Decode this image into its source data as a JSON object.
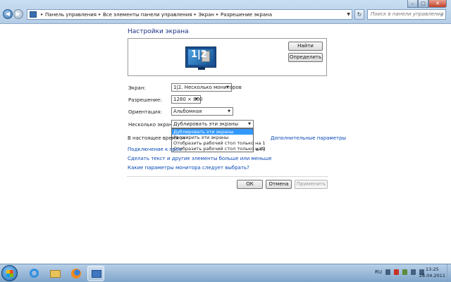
{
  "address_bar": {
    "crumbs": [
      "Панель управления",
      "Все элементы панели управления",
      "Экран",
      "Разрешение экрана"
    ],
    "search_placeholder": "Поиск в панели управления"
  },
  "window_controls": {
    "minimize": "–",
    "maximize": "□",
    "close": "✕"
  },
  "main": {
    "title": "Настройки экрана",
    "monitor_label": "1|2",
    "find_button": "Найти",
    "detect_button": "Определить",
    "fields": {
      "display_label": "Экран:",
      "display_value": "1|2. Несколько мониторов",
      "resolution_label": "Разрешение:",
      "resolution_value": "1280 × 800",
      "orientation_label": "Ориентация:",
      "orientation_value": "Альбомная",
      "multiple_label": "Несколько экранов:",
      "multiple_value": "Дублировать эти экраны"
    },
    "dropdown_options": [
      "Дублировать эти экраны",
      "Расширить эти экраны",
      "Отобразить рабочий стол только на 1",
      "Отобразить рабочий стол только на 2"
    ],
    "primary_text_partial": "В настоящее время эт",
    "advanced_link": "Дополнительные параметры",
    "projector_link_partial": "Подключение к прое",
    "projector_tail": "ь P)",
    "text_size_link": "Сделать текст и другие элементы больше или меньше",
    "which_settings_link": "Какие параметры монитора следует выбрать?"
  },
  "footer": {
    "ok": "ОК",
    "cancel": "Отмена",
    "apply": "Применить"
  },
  "taskbar": {
    "apps": [
      "internet-explorer",
      "windows-explorer",
      "firefox",
      "control-panel"
    ],
    "lang": "RU",
    "time": "13:25",
    "date": "28.04.2011"
  }
}
